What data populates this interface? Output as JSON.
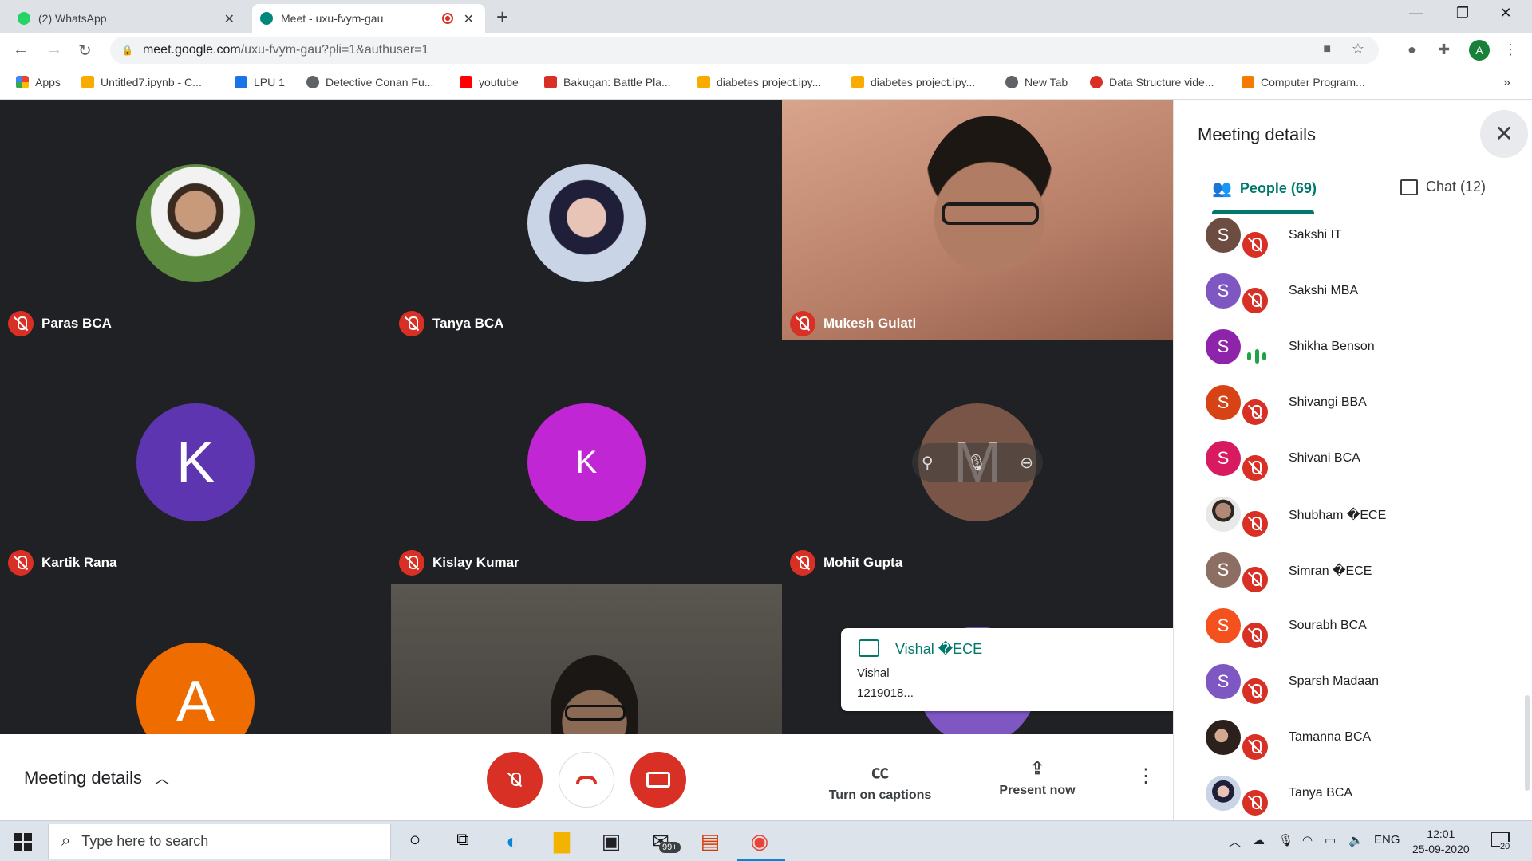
{
  "browser": {
    "tabs": [
      {
        "title": "(2) WhatsApp"
      },
      {
        "title": "Meet - uxu-fvym-gau"
      }
    ],
    "url_host": "meet.google.com",
    "url_path": "/uxu-fvym-gau?pli=1&authuser=1",
    "profile_initial": "A",
    "bookmarks": [
      {
        "label": "Apps",
        "color": "#ea4335"
      },
      {
        "label": "Untitled7.ipynb - C...",
        "color": "#f9ab00"
      },
      {
        "label": "LPU 1",
        "color": "#1a73e8"
      },
      {
        "label": "Detective Conan Fu...",
        "color": "#5f6368"
      },
      {
        "label": "youtube",
        "color": "#ff0000"
      },
      {
        "label": "Bakugan: Battle Pla...",
        "color": "#d93025"
      },
      {
        "label": "diabetes project.ipy...",
        "color": "#f9ab00"
      },
      {
        "label": "diabetes project.ipy...",
        "color": "#f9ab00"
      },
      {
        "label": "New Tab",
        "color": "#5f6368"
      },
      {
        "label": "Data Structure vide...",
        "color": "#d93025"
      },
      {
        "label": "Computer Program...",
        "color": "#f57c00"
      }
    ]
  },
  "tiles": [
    {
      "name": "Paras BCA",
      "initial": "",
      "bg": "#6b8f4e"
    },
    {
      "name": "Tanya BCA",
      "initial": "",
      "bg": "#3a3f6e"
    },
    {
      "name": "Mukesh Gulati",
      "initial": "",
      "bg": "#c99a83"
    },
    {
      "name": "Kartik Rana",
      "initial": "K",
      "bg": "#5e35b1"
    },
    {
      "name": "Kislay Kumar",
      "initial": "K",
      "bg": "#c026d3"
    },
    {
      "name": "Mohit Gupta",
      "initial": "M",
      "bg": "#795548"
    },
    {
      "name": "",
      "initial": "A",
      "bg": "#ef6c00"
    }
  ],
  "notification": {
    "sender": "Vishal �ECE",
    "line1": "Vishal",
    "line2": "1219018..."
  },
  "controls": {
    "meeting_details": "Meeting details",
    "captions": "Turn on captions",
    "present": "Present now"
  },
  "panel": {
    "title": "Meeting details",
    "people_tab": "People (69)",
    "chat_tab": "Chat (12)",
    "people": [
      {
        "name": "Sakshi IT",
        "initial": "S",
        "color": "#6d4c41",
        "state": "muted"
      },
      {
        "name": "Sakshi MBA",
        "initial": "S",
        "color": "#7e57c2",
        "state": "muted"
      },
      {
        "name": "Shikha Benson",
        "initial": "S",
        "color": "#8e24aa",
        "state": "speaking"
      },
      {
        "name": "Shivangi BBA",
        "initial": "S",
        "color": "#d84315",
        "state": "muted"
      },
      {
        "name": "Shivani BCA",
        "initial": "S",
        "color": "#d81b60",
        "state": "muted"
      },
      {
        "name": "Shubham �ECE",
        "initial": "",
        "color": "#9e9e9e",
        "state": "muted"
      },
      {
        "name": "Simran �ECE",
        "initial": "S",
        "color": "#8d6e63",
        "state": "muted"
      },
      {
        "name": "Sourabh BCA",
        "initial": "S",
        "color": "#f4511e",
        "state": "muted"
      },
      {
        "name": "Sparsh Madaan",
        "initial": "S",
        "color": "#7e57c2",
        "state": "muted"
      },
      {
        "name": "Tamanna BCA",
        "initial": "",
        "color": "#4e342e",
        "state": "muted"
      },
      {
        "name": "Tanya BCA",
        "initial": "",
        "color": "#3a3f6e",
        "state": "muted"
      }
    ]
  },
  "taskbar": {
    "search_placeholder": "Type here to search",
    "mail_badge": "99+",
    "lang": "ENG",
    "time": "12:01",
    "date": "25-09-2020",
    "notif_count": "20"
  }
}
